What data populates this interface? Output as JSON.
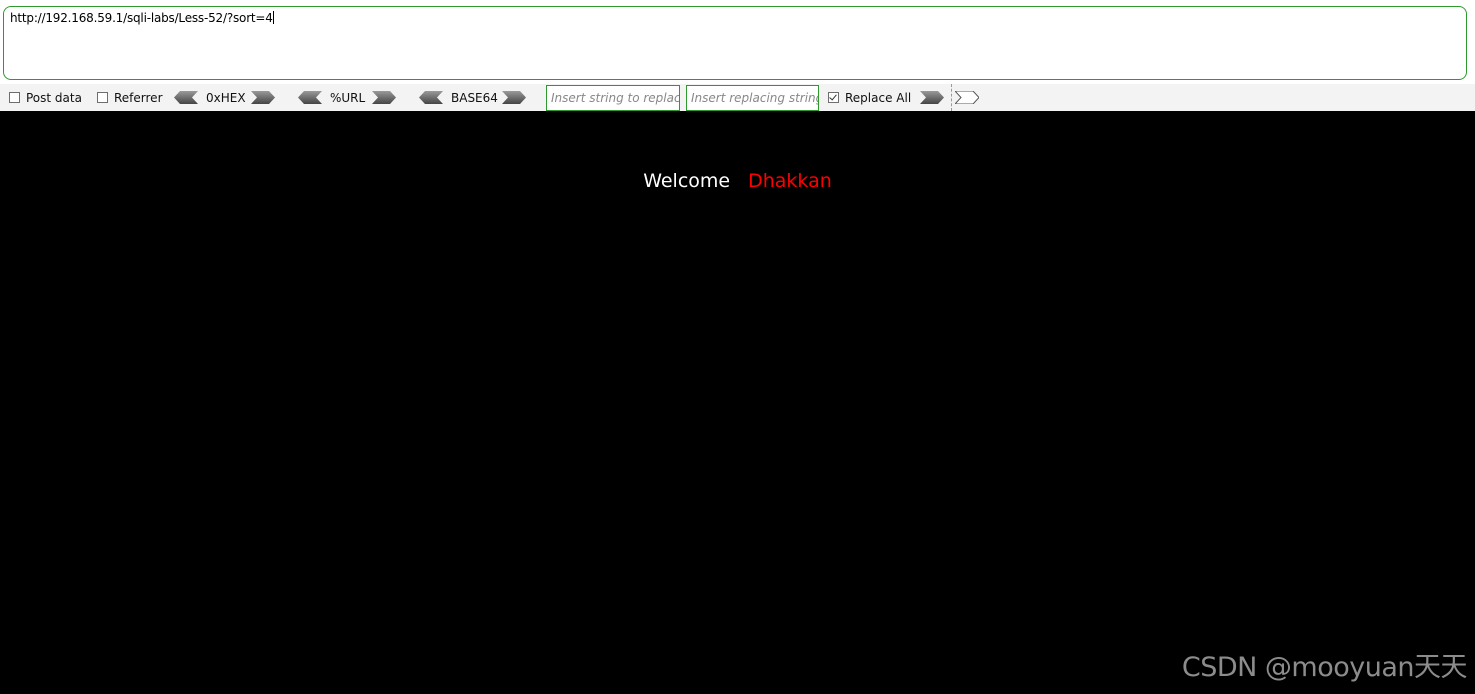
{
  "address_bar": {
    "url": "http://192.168.59.1/sqli-labs/Less-52/?sort=4"
  },
  "hackbar": {
    "post_data": {
      "label": "Post data",
      "checked": false
    },
    "referrer": {
      "label": "Referrer",
      "checked": false
    },
    "hex": {
      "label": "0xHEX"
    },
    "url_encode": {
      "label": "%URL"
    },
    "base64": {
      "label": "BASE64"
    },
    "replace_search": {
      "placeholder": "Insert string to replace"
    },
    "replace_with": {
      "placeholder": "Insert replacing string"
    },
    "replace_all": {
      "label": "Replace All",
      "checked": true
    }
  },
  "page": {
    "welcome": "Welcome",
    "username": "Dhakkan",
    "welcome_color": "#ffffff",
    "username_color": "#ff0000"
  },
  "watermark": {
    "text": "CSDN @mooyuan天天"
  },
  "icons": {
    "left_arrow": "double-chevron-left-icon",
    "right_arrow": "double-chevron-right-icon"
  }
}
